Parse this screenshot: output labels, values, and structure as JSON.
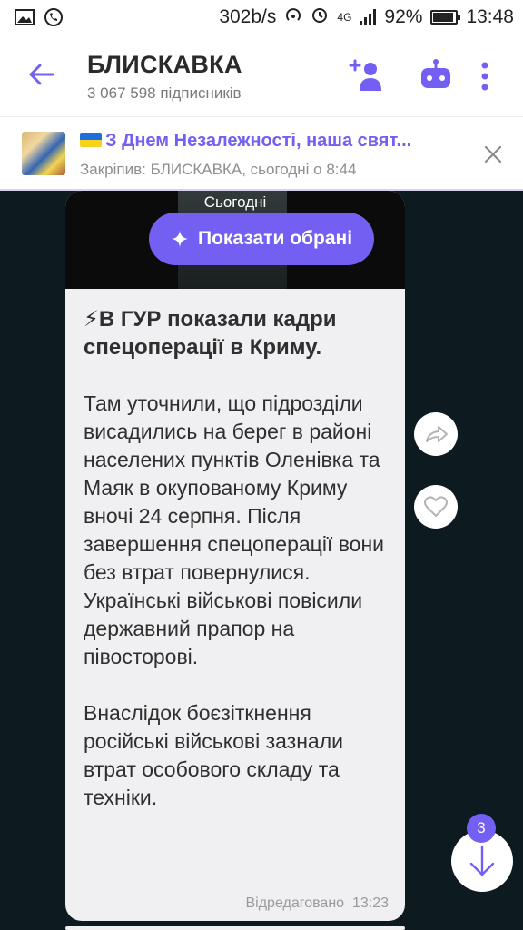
{
  "status_bar": {
    "net_speed": "302b/s",
    "network": "4G",
    "battery": "92%",
    "battery_level": 0.92,
    "time": "13:48"
  },
  "header": {
    "title": "БЛИСКАВКА",
    "subscribers": "3 067 598 підписників"
  },
  "pinned": {
    "title": "З Днем Незалежності, наша свят...",
    "subtitle": "Закріпив: БЛИСКАВКА, сьогодні о 8:44"
  },
  "chat": {
    "date_label": "Сьогодні",
    "show_favorites": "Показати обрані",
    "message": {
      "headline": "⚡В ГУР показали кадри спецоперації в Криму.",
      "paragraph1": "Там уточнили, що підрозділи висадились на берег в районі населених пунктів Оленівка та Маяк в окупованому Криму вночі 24 серпня. Після завершення спецоперації вони без втрат повернулися. Українські військові повісили державний прапор на півосторові.",
      "paragraph2": "Внаслідок боєзіткнення російські військові зазнали втрат особового складу та техніки.",
      "edited_label": "Відредаговано",
      "time": "13:23"
    },
    "unread_count": "3"
  },
  "colors": {
    "accent": "#7360f2",
    "chat_background": "#0d1a1f",
    "bubble": "#f0f0f2"
  },
  "icons": {
    "back": "arrow-left-icon",
    "add_member": "add-person-icon",
    "bot": "robot-icon",
    "more": "kebab-menu-icon",
    "close_pin": "close-icon",
    "share": "share-icon",
    "like": "heart-icon",
    "scroll_down": "arrow-down-icon"
  }
}
